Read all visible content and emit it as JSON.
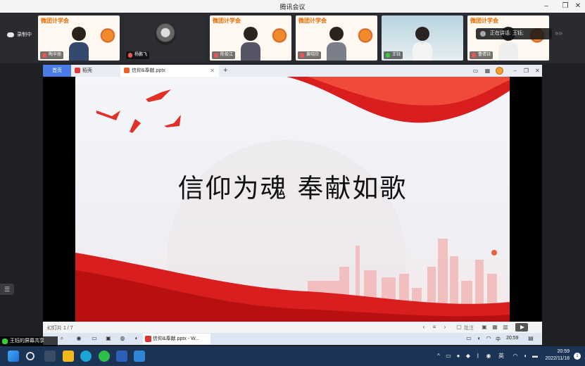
{
  "meeting": {
    "title": "腾讯会议",
    "window_controls": [
      "minimize",
      "restore",
      "close"
    ],
    "recording_label": "录制中",
    "speaking_label": "正在讲话: 王钰;",
    "participants": [
      {
        "name": "陶辛丽",
        "banner": "微团计学会",
        "mic": "muted",
        "style": "banner"
      },
      {
        "name": "杨鹏飞",
        "banner": "",
        "mic": "muted",
        "style": "dark"
      },
      {
        "name": "陈俊江",
        "banner": "微团计学会",
        "mic": "muted",
        "style": "banner"
      },
      {
        "name": "黄晓欣",
        "banner": "微团计学会",
        "mic": "muted",
        "style": "banner"
      },
      {
        "name": "王钰",
        "banner": "",
        "mic": "on",
        "style": "cyan"
      },
      {
        "name": "曹倩钰",
        "banner": "微团计学会",
        "mic": "muted",
        "style": "banner"
      }
    ]
  },
  "wps": {
    "tabs": [
      {
        "label": "首页",
        "active": false
      },
      {
        "label": "稻壳",
        "active": false
      },
      {
        "label": "信仰&奉献.pptx",
        "active": true
      }
    ],
    "new_tab_symbol": "+",
    "slide": {
      "title": "信仰为魂   奉献如歌"
    },
    "status": {
      "slide_counter": "幻灯片 1 / 7",
      "annotate_label": "批注"
    }
  },
  "shared_taskbar": {
    "app_label": "信仰&奉献.pptx - W...",
    "ime": "中",
    "time": "20:59"
  },
  "share_label": "王钰的屏幕共享",
  "system": {
    "language": "英",
    "time": "20:59",
    "date": "2022/11/18",
    "notification_count": "1"
  },
  "colors": {
    "wps_blue": "#4a7be6",
    "ribbon_red": "#d81e1e",
    "taskbar": "#1b3355"
  }
}
